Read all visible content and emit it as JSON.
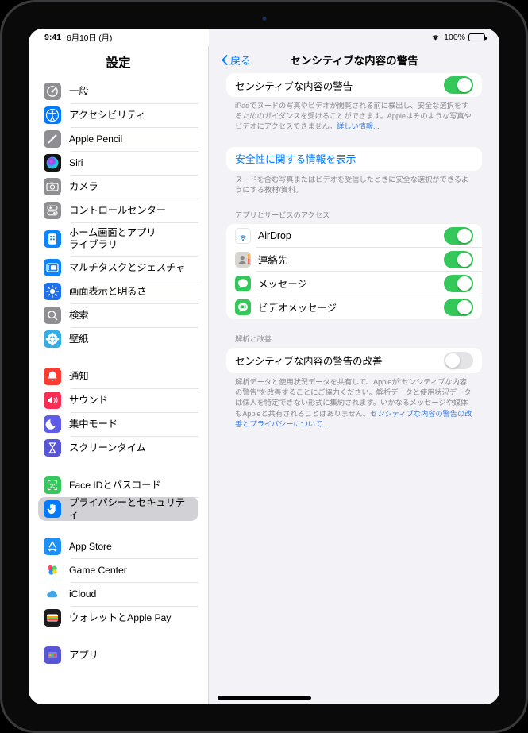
{
  "statusbar": {
    "time": "9:41",
    "date": "6月10日 (月)",
    "battery_percent": "100%",
    "wifi_icon": "wifi-icon",
    "battery_icon": "battery-icon"
  },
  "sidebar": {
    "title": "設定",
    "groups": [
      {
        "items": [
          {
            "label": "一般",
            "icon": "gear-icon",
            "color": "#8e8e93",
            "selected": false
          },
          {
            "label": "アクセシビリティ",
            "icon": "accessibility-icon",
            "color": "#007aff",
            "selected": false
          },
          {
            "label": "Apple Pencil",
            "icon": "pencil-icon",
            "color": "#8e8e93",
            "selected": false
          },
          {
            "label": "Siri",
            "icon": "siri-icon",
            "color": "#1c1c1e",
            "selected": false
          },
          {
            "label": "カメラ",
            "icon": "camera-icon",
            "color": "#8e8e93",
            "selected": false
          },
          {
            "label": "コントロールセンター",
            "icon": "control-center-icon",
            "color": "#8e8e93",
            "selected": false
          },
          {
            "label": "ホーム画面とアプリ\nライブラリ",
            "icon": "home-screen-icon",
            "color": "#0a84ff",
            "selected": false,
            "two_line": true
          },
          {
            "label": "マルチタスクとジェスチャ",
            "icon": "multitasking-icon",
            "color": "#0a84ff",
            "selected": false
          },
          {
            "label": "画面表示と明るさ",
            "icon": "display-brightness-icon",
            "color": "#1e6ff0",
            "selected": false
          },
          {
            "label": "検索",
            "icon": "search-icon",
            "color": "#8e8e93",
            "selected": false
          },
          {
            "label": "壁紙",
            "icon": "wallpaper-icon",
            "color": "#32ade6",
            "selected": false
          }
        ]
      },
      {
        "items": [
          {
            "label": "通知",
            "icon": "notifications-icon",
            "color": "#ff3b30",
            "selected": false
          },
          {
            "label": "サウンド",
            "icon": "sound-icon",
            "color": "#fc2d55",
            "selected": false
          },
          {
            "label": "集中モード",
            "icon": "focus-icon",
            "color": "#5e5ce6",
            "selected": false
          },
          {
            "label": "スクリーンタイム",
            "icon": "screen-time-icon",
            "color": "#5856d6",
            "selected": false
          }
        ]
      },
      {
        "items": [
          {
            "label": "Face IDとパスコード",
            "icon": "face-id-icon",
            "color": "#34c759",
            "selected": false
          },
          {
            "label": "プライバシーとセキュリティ",
            "icon": "privacy-hand-icon",
            "color": "#007aff",
            "selected": true
          }
        ]
      },
      {
        "items": [
          {
            "label": "App Store",
            "icon": "app-store-icon",
            "color": "#1e8ff5",
            "selected": false
          },
          {
            "label": "Game Center",
            "icon": "game-center-icon",
            "color": "#ffffff",
            "selected": false
          },
          {
            "label": "iCloud",
            "icon": "icloud-icon",
            "color": "#ffffff",
            "selected": false
          },
          {
            "label": "ウォレットとApple Pay",
            "icon": "wallet-icon",
            "color": "#1c1c1e",
            "selected": false
          }
        ]
      },
      {
        "items": [
          {
            "label": "アプリ",
            "icon": "apps-icon",
            "color": "#5856d6",
            "selected": false
          }
        ]
      }
    ]
  },
  "detail": {
    "back_label": "戻る",
    "title": "センシティブな内容の警告",
    "main_toggle": {
      "label": "センシティブな内容の警告",
      "state": "on"
    },
    "main_footer": {
      "text": "iPadでヌードの写真やビデオが閲覧される前に検出し、安全な選択をするためのガイダンスを受けることができます。Appleはそのような写真やビデオにアクセスできません。",
      "link": "詳しい情報..."
    },
    "safety_row": {
      "label": "安全性に関する情報を表示"
    },
    "safety_footer": {
      "text": "ヌードを含む写真またはビデオを受信したときに安全な選択ができるようにする教材/資料。"
    },
    "apps_section": {
      "header": "アプリとサービスのアクセス",
      "rows": [
        {
          "label": "AirDrop",
          "icon": "airdrop-icon",
          "state": "on"
        },
        {
          "label": "連絡先",
          "icon": "contacts-icon",
          "state": "on"
        },
        {
          "label": "メッセージ",
          "icon": "messages-icon",
          "state": "on"
        },
        {
          "label": "ビデオメッセージ",
          "icon": "video-messages-icon",
          "state": "on"
        }
      ]
    },
    "analytics_section": {
      "header": "解析と改善",
      "row": {
        "label": "センシティブな内容の警告の改善",
        "state": "off"
      },
      "footer": {
        "text": "解析データと使用状況データを共有して、Appleが\"センシティブな内容の警告\"を改善することにご協力ください。解析データと使用状況データは個人を特定できない形式に集約されます。いかなるメッセージや媒体もAppleと共有されることはありません。",
        "link": "センシティブな内容の警告の改善とプライバシーについて..."
      }
    }
  },
  "colors": {
    "accent": "#007aff",
    "toggle_on": "#34c759",
    "toggle_off": "#e4e4e6",
    "background": "#f2f2f7",
    "card": "#ffffff"
  }
}
